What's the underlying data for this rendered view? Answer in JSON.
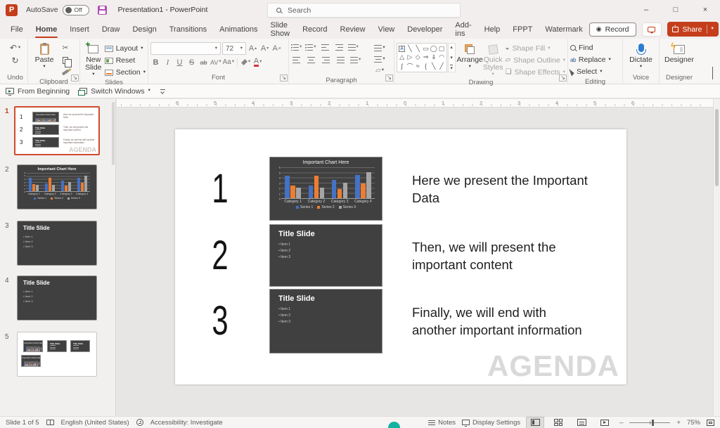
{
  "titlebar": {
    "autosave_label": "AutoSave",
    "autosave_state": "Off",
    "title": "Presentation1  -  PowerPoint",
    "search_placeholder": "Search",
    "app_letter": "P"
  },
  "win_controls": {
    "minimize": "–",
    "maximize": "□",
    "close": "×"
  },
  "tabs": {
    "items": [
      "File",
      "Home",
      "Insert",
      "Draw",
      "Design",
      "Transitions",
      "Animations",
      "Slide Show",
      "Record",
      "Review",
      "View",
      "Developer",
      "Add-ins",
      "Help",
      "FPPT",
      "Watermark"
    ],
    "active": "Home",
    "record_button": "Record",
    "share_button": "Share"
  },
  "quickbar": {
    "from_beginning": "From Beginning",
    "switch_windows": "Switch Windows"
  },
  "ribbon": {
    "groups": [
      "Undo",
      "Clipboard",
      "Slides",
      "Font",
      "Paragraph",
      "Drawing",
      "Editing",
      "Voice",
      "Designer"
    ],
    "clipboard": {
      "paste": "Paste"
    },
    "slides": {
      "new_slide": "New Slide",
      "layout": "Layout",
      "reset": "Reset",
      "section": "Section"
    },
    "font": {
      "size": "72",
      "bold": "B",
      "italic": "I",
      "underline": "U",
      "strike": "S",
      "strike_ab": "ab",
      "spacing": "AV",
      "case": "Aa",
      "color": "A"
    },
    "drawing": {
      "arrange": "Arrange",
      "quick_styles": "Quick Styles",
      "shape_fill": "Shape Fill",
      "shape_outline": "Shape Outline",
      "shape_effects": "Shape Effects"
    },
    "editing": {
      "find": "Find",
      "replace": "Replace",
      "select": "Select"
    },
    "voice": {
      "dictate": "Dictate"
    },
    "designer": {
      "designer": "Designer"
    }
  },
  "icons": {
    "undo": "↶",
    "redo": "↻",
    "cut": "✂",
    "caret": "▾",
    "scroll_up": "▴",
    "scroll_down": "▾",
    "launcher": "↘",
    "record_dot": "◉",
    "minus": "–",
    "plus": "+",
    "grow_font": "A",
    "shrink_font": "A",
    "clear_format": "A",
    "gallery": [
      [
        "A",
        "╲",
        "╲",
        "▭",
        "◯",
        "▢"
      ],
      [
        "△",
        "▷",
        "◇",
        "⇒",
        "⇓",
        "◠"
      ],
      [
        "ʃ",
        "⌒",
        "≈",
        "{",
        "╲",
        "╱"
      ]
    ]
  },
  "ruler": {
    "numbers": [
      "6",
      "5",
      "4",
      "3",
      "2",
      "1",
      "0",
      "1",
      "2",
      "3",
      "4",
      "5",
      "6"
    ]
  },
  "panel": {
    "slides": [
      {
        "num": "1",
        "type": "agenda"
      },
      {
        "num": "2",
        "type": "chart"
      },
      {
        "num": "3",
        "type": "title"
      },
      {
        "num": "4",
        "type": "title"
      },
      {
        "num": "5",
        "type": "overview"
      }
    ]
  },
  "slide": {
    "rows": [
      {
        "num": "1",
        "thumb": "chart",
        "text": "Here we present the Important Data"
      },
      {
        "num": "2",
        "thumb": "title",
        "text": "Then, we will present the important content"
      },
      {
        "num": "3",
        "thumb": "title",
        "text": "Finally, we will end with another important information"
      }
    ],
    "title_slide": {
      "title": "Title Slide",
      "items": [
        "Item 1",
        "Item 2",
        "Item 3"
      ]
    },
    "watermark": "AGENDA"
  },
  "chart_data": {
    "type": "bar",
    "title": "Important Chart Here",
    "categories": [
      "Category 1",
      "Category 2",
      "Category 3",
      "Category 4"
    ],
    "series": [
      {
        "name": "Series 1",
        "color": "#4472c4",
        "values": [
          4.3,
          2.5,
          3.5,
          4.5
        ]
      },
      {
        "name": "Series 2",
        "color": "#ed7d31",
        "values": [
          2.4,
          4.4,
          1.8,
          2.8
        ]
      },
      {
        "name": "Series 3",
        "color": "#a5a5a5",
        "values": [
          2.0,
          2.0,
          3.0,
          5.0
        ]
      }
    ],
    "ylim": [
      0,
      6
    ],
    "yticks": [
      0,
      1,
      2,
      3,
      4,
      5,
      6
    ],
    "grid": true,
    "legend_position": "bottom"
  },
  "statusbar": {
    "slide_indicator": "Slide 1 of 5",
    "language": "English (United States)",
    "accessibility": "Accessibility: Investigate",
    "notes": "Notes",
    "display_settings": "Display Settings",
    "zoom_level": "75%"
  }
}
